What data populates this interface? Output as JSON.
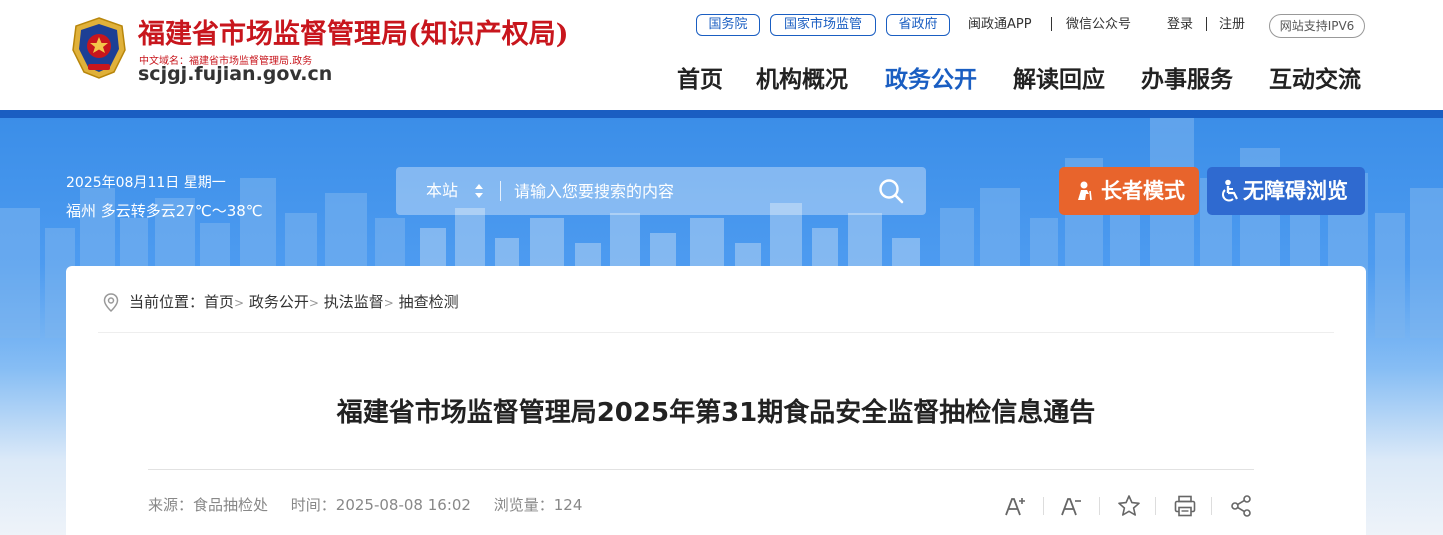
{
  "site": {
    "title": "福建省市场监督管理局(知识产权局)",
    "cn_domain": "中文域名：福建省市场监督管理局.政务",
    "domain": "scjgj.fujian.gov.cn"
  },
  "toplinks": {
    "guowuyuan": "国务院",
    "guojia": "国家市场监管",
    "shengzhengfu": "省政府",
    "mzt_app": "闽政通APP",
    "wechat": "微信公众号",
    "login": "登录",
    "register": "注册",
    "ipv6": "网站支持IPV6"
  },
  "nav": {
    "items": [
      {
        "label": "首页"
      },
      {
        "label": "机构概况"
      },
      {
        "label": "政务公开",
        "active": true
      },
      {
        "label": "解读回应"
      },
      {
        "label": "办事服务"
      },
      {
        "label": "互动交流"
      }
    ]
  },
  "banner": {
    "date": "2025年08月11日 星期一",
    "weather": "福州 多云转多云27℃～38℃",
    "search": {
      "scope": "本站",
      "placeholder": "请输入您要搜索的内容"
    },
    "elder_mode": "长者模式",
    "accessible": "无障碍浏览"
  },
  "breadcrumb": {
    "prefix": "当前位置：",
    "items": [
      "首页",
      "政务公开",
      "执法监督",
      "抽查检测"
    ],
    "separator": ">"
  },
  "article": {
    "title": "福建省市场监督管理局2025年第31期食品安全监督抽检信息通告",
    "source": "来源：食品抽检处",
    "time": "时间：2025-08-08 16:02",
    "views": "浏览量：124"
  },
  "colors": {
    "brand_red": "#c8161d",
    "brand_blue": "#1a5ec2",
    "elder_orange": "#e8642c"
  },
  "icons": [
    "font-increase-icon",
    "font-decrease-icon",
    "star-icon",
    "print-icon",
    "share-icon",
    "search-icon",
    "location-icon",
    "elder-icon",
    "wheelchair-icon"
  ]
}
